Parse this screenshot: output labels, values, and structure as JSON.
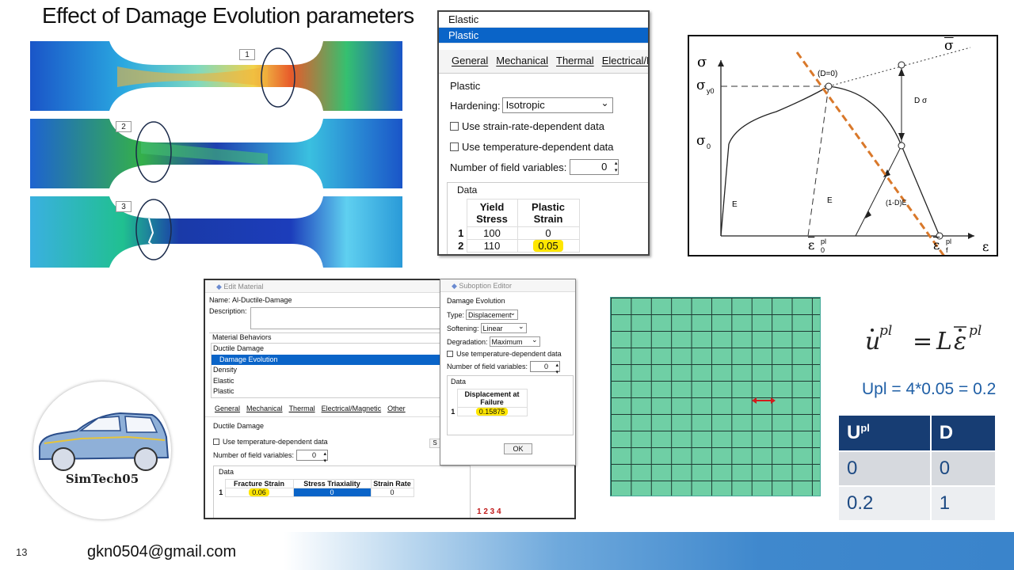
{
  "slide": {
    "title": "Effect of Damage Evolution parameters",
    "page_number": "13",
    "email": "gkn0504@gmail.com"
  },
  "contour_panel": {
    "tags": [
      "1",
      "2",
      "3"
    ]
  },
  "plastic_window": {
    "list_items": [
      "Elastic",
      "Plastic"
    ],
    "selected_item": "Plastic",
    "menu": [
      "General",
      "Mechanical",
      "Thermal",
      "Electrical/M"
    ],
    "group_label": "Plastic",
    "hardening_label": "Hardening:",
    "hardening_value": "Isotropic",
    "strain_rate_checkbox": "Use strain-rate-dependent data",
    "temperature_checkbox": "Use temperature-dependent data",
    "field_vars_label": "Number of field variables:",
    "field_vars_value": "0",
    "data_label": "Data",
    "col1": "Yield Stress",
    "col2": "Plastic Strain",
    "rows": [
      {
        "idx": "1",
        "stress": "100",
        "strain": "0"
      },
      {
        "idx": "2",
        "stress": "110",
        "strain": "0.05"
      }
    ]
  },
  "diagram": {
    "sigma": "σ",
    "sigma_bar": "σ",
    "sigma_y0": "σ",
    "sigma_y0_sub": "y0",
    "sigma_0": "σ",
    "sigma_0_sub": "0",
    "D0": "(D=0)",
    "D_sigma": "D σ",
    "E1": "E",
    "E2": "E",
    "one_minus_D_E": "(1-D)E",
    "eps": "ε",
    "eps0": "ε",
    "eps0_sup": "pl",
    "eps0_sub": "0",
    "epsf": "ε",
    "epsf_sup": "pl",
    "epsf_sub": "f"
  },
  "edit_material": {
    "title": "Edit Material",
    "name_label": "Name:",
    "name_value": "Al-Ductile-Damage",
    "description_label": "Description:",
    "behaviors_label": "Material Behaviors",
    "behaviors": [
      "Ductile Damage",
      "Damage Evolution",
      "Density",
      "Elastic",
      "Plastic"
    ],
    "selected_behavior": "Damage Evolution",
    "menu": [
      "General",
      "Mechanical",
      "Thermal",
      "Electrical/Magnetic",
      "Other"
    ],
    "section_label": "Ductile Damage",
    "temp_checkbox": "Use temperature-dependent data",
    "field_vars_label": "Number of field variables:",
    "field_vars_value": "0",
    "data_label": "Data",
    "col1": "Fracture Strain",
    "col2": "Stress Triaxiality",
    "col3": "Strain Rate",
    "row_idx": "1",
    "fracture_strain": "0.06",
    "stress_triax": "0",
    "strain_rate": "0",
    "side_btn": "S",
    "toolbar_nums": "1 2 3 4"
  },
  "suboption": {
    "title": "Suboption Editor",
    "section": "Damage Evolution",
    "type_label": "Type:",
    "type_value": "Displacement",
    "softening_label": "Softening:",
    "softening_value": "Linear",
    "degradation_label": "Degradation:",
    "degradation_value": "Maximum",
    "temp_checkbox": "Use temperature-dependent data",
    "field_vars_label": "Number of field variables:",
    "field_vars_value": "0",
    "data_label": "Data",
    "col": "Displacement at Failure",
    "row_idx": "1",
    "value": "0.15875",
    "ok": "OK"
  },
  "right": {
    "upl_equation": "Upl = 4*0.05 = 0.2",
    "table_headers": [
      "U",
      "D"
    ],
    "table_header_sup": "pl",
    "table_rows": [
      [
        "0",
        "0"
      ],
      [
        "0.2",
        "1"
      ]
    ]
  },
  "logo": {
    "text": "SimTech05"
  },
  "colors": {
    "accent_blue": "#0a64c8",
    "table_header": "#173d73",
    "highlight": "#ffe600",
    "mesh": "#6fcfa5",
    "dashed_line": "#d9782a"
  }
}
